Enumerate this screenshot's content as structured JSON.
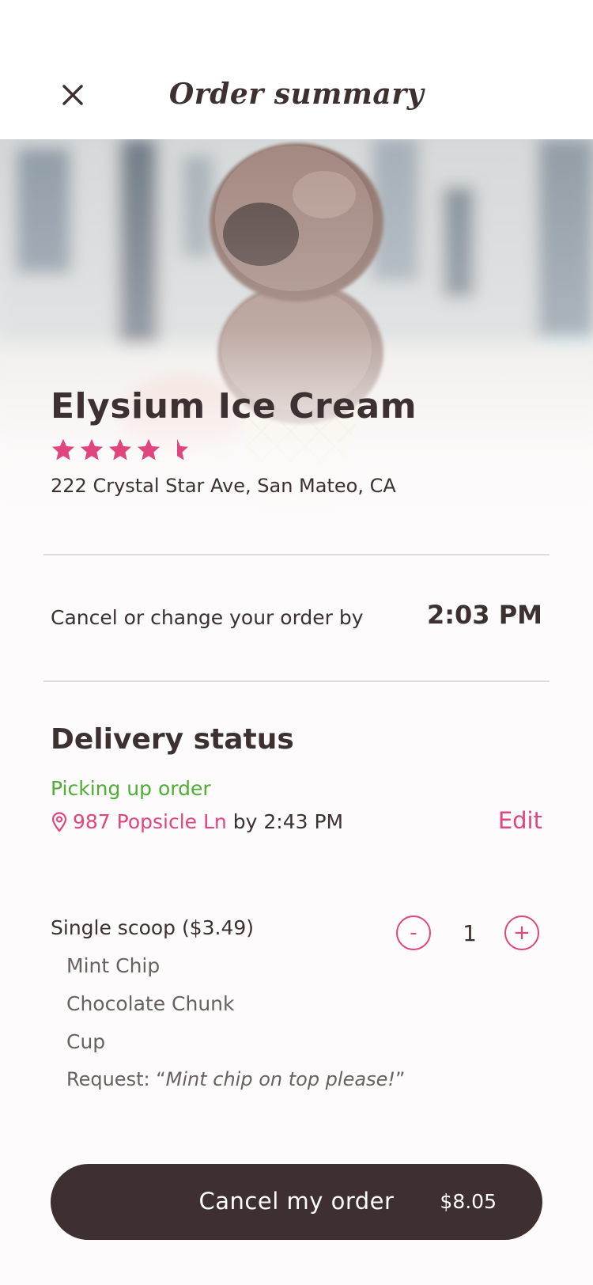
{
  "header": {
    "title": "Order summary"
  },
  "store": {
    "name": "Elysium Ice Cream",
    "rating": 4.5,
    "rating_max": 5,
    "address": "222 Crystal Star Ave,  San Mateo, CA"
  },
  "cancel_by": {
    "label": "Cancel or change your order by",
    "time": "2:03 PM"
  },
  "delivery": {
    "title": "Delivery status",
    "status": "Picking up order",
    "address": "987 Popsicle Ln",
    "by_text": "by 2:43 PM",
    "edit_label": "Edit"
  },
  "item": {
    "title": "Single scoop ($3.49)",
    "options": [
      "Mint Chip",
      "Chocolate Chunk",
      "Cup"
    ],
    "request_prefix": "Request: “",
    "request_text": "Mint chip on top please!",
    "request_suffix": "”",
    "quantity": "1",
    "minus_label": "-",
    "plus_label": "+"
  },
  "footer": {
    "cancel_label": "Cancel my order",
    "total": "$8.05"
  },
  "colors": {
    "accent": "#e0457e",
    "status_green": "#4caf33",
    "dark": "#3e3030"
  },
  "icons": {
    "close": "close-icon",
    "star": "star-icon",
    "location": "location-pin-icon"
  }
}
